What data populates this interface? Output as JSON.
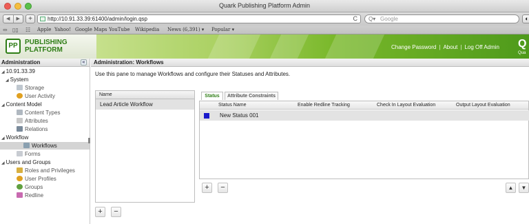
{
  "window": {
    "title": "Quark Publishing Platform Admin"
  },
  "browser": {
    "nav_back": "◀",
    "nav_forward": "▶",
    "add": "+",
    "url": "http://10.91.33.39:61400/admin/login.qsp",
    "reload_icon": "C",
    "search_placeholder": "Google",
    "bookmarks": [
      "Apple",
      "Yahoo!",
      "Google Maps",
      "YouTube",
      "Wikipedia",
      "News (6,391) ▾",
      "Popular ▾"
    ]
  },
  "header": {
    "logo_mark": "PP",
    "logo_line1": "PUBLISHING",
    "logo_line2": "PLATFORM",
    "links": [
      "Change Password",
      "About",
      "Log Off Admin"
    ],
    "brand_mark": "Q",
    "brand_text": "Qua"
  },
  "sidebar": {
    "title": "Administration",
    "collapse_glyph": "«",
    "server": "10.91.33.39",
    "system": "System",
    "storage": "Storage",
    "user_activity": "User Activity",
    "content_model": "Content Model",
    "content_types": "Content Types",
    "attributes": "Attributes",
    "relations": "Relations",
    "workflow": "Workflow",
    "workflows": "Workflows",
    "forms": "Forms",
    "users_groups": "Users and Groups",
    "roles": "Roles and Privileges",
    "user_profiles": "User Profiles",
    "groups": "Groups",
    "redline": "Redline"
  },
  "main": {
    "title": "Administration: Workflows",
    "description": "Use this pane to manage Workflows and configure their Statuses and Attributes.",
    "workflow_list": {
      "header": "Name",
      "rows": [
        "Lead Article Workflow"
      ]
    },
    "add_label": "+",
    "remove_label": "−",
    "tabs": {
      "status": "Status",
      "attribute_constraints": "Attribute Constraints"
    },
    "status_table": {
      "columns": [
        "Status Name",
        "Enable Redline Tracking",
        "Check In Layout Evaluation",
        "Output Layout Evaluation"
      ],
      "rows": [
        {
          "name": "New Status 001",
          "color": "#1a1acb"
        }
      ]
    },
    "move_up": "▲",
    "move_down": "▼"
  },
  "colors": {
    "brand_green": "#2e7d15",
    "header_green": "#79b82a",
    "selection_gray": "#e2e2e2"
  }
}
